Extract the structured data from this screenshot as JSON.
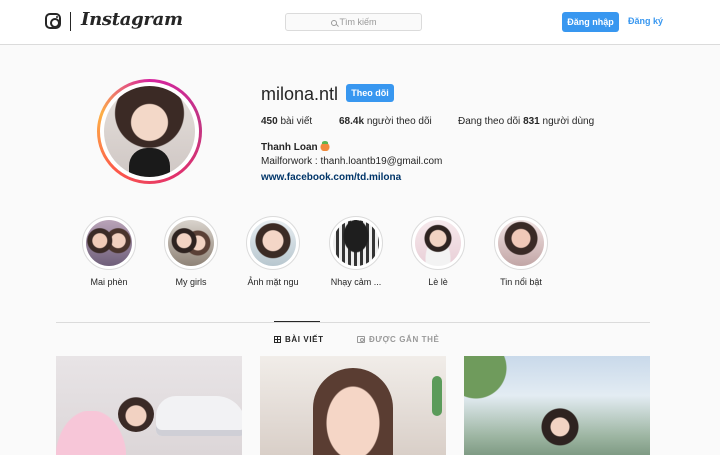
{
  "header": {
    "brand": "Instagram",
    "search_placeholder": "Tìm kiếm",
    "login_label": "Đăng nhập",
    "signup_label": "Đăng ký"
  },
  "profile": {
    "username": "milona.ntl",
    "follow_label": "Theo dõi",
    "stats": {
      "posts_count": "450",
      "posts_label": "bài viết",
      "followers_count": "68.4k",
      "followers_label": "người theo dõi",
      "following_prefix": "Đang theo dõi",
      "following_count": "831",
      "following_label": "người dùng"
    },
    "full_name": "Thanh Loan",
    "bio": "Mailforwork : thanh.loantb19@gmail.com",
    "website": "www.facebook.com/td.milona"
  },
  "highlights": [
    {
      "label": "Mai phèn"
    },
    {
      "label": "My girls"
    },
    {
      "label": "Ảnh mặt ngu"
    },
    {
      "label": "Nhạy cảm ..."
    },
    {
      "label": "Lè lè"
    },
    {
      "label": "Tin nổi bật"
    }
  ],
  "tabs": {
    "posts": "BÀI VIẾT",
    "tagged": "ĐƯỢC GẮN THẺ"
  },
  "colors": {
    "accent": "#3897f0",
    "link": "#003569",
    "border": "#dbdbdb",
    "background": "#fafafa"
  }
}
